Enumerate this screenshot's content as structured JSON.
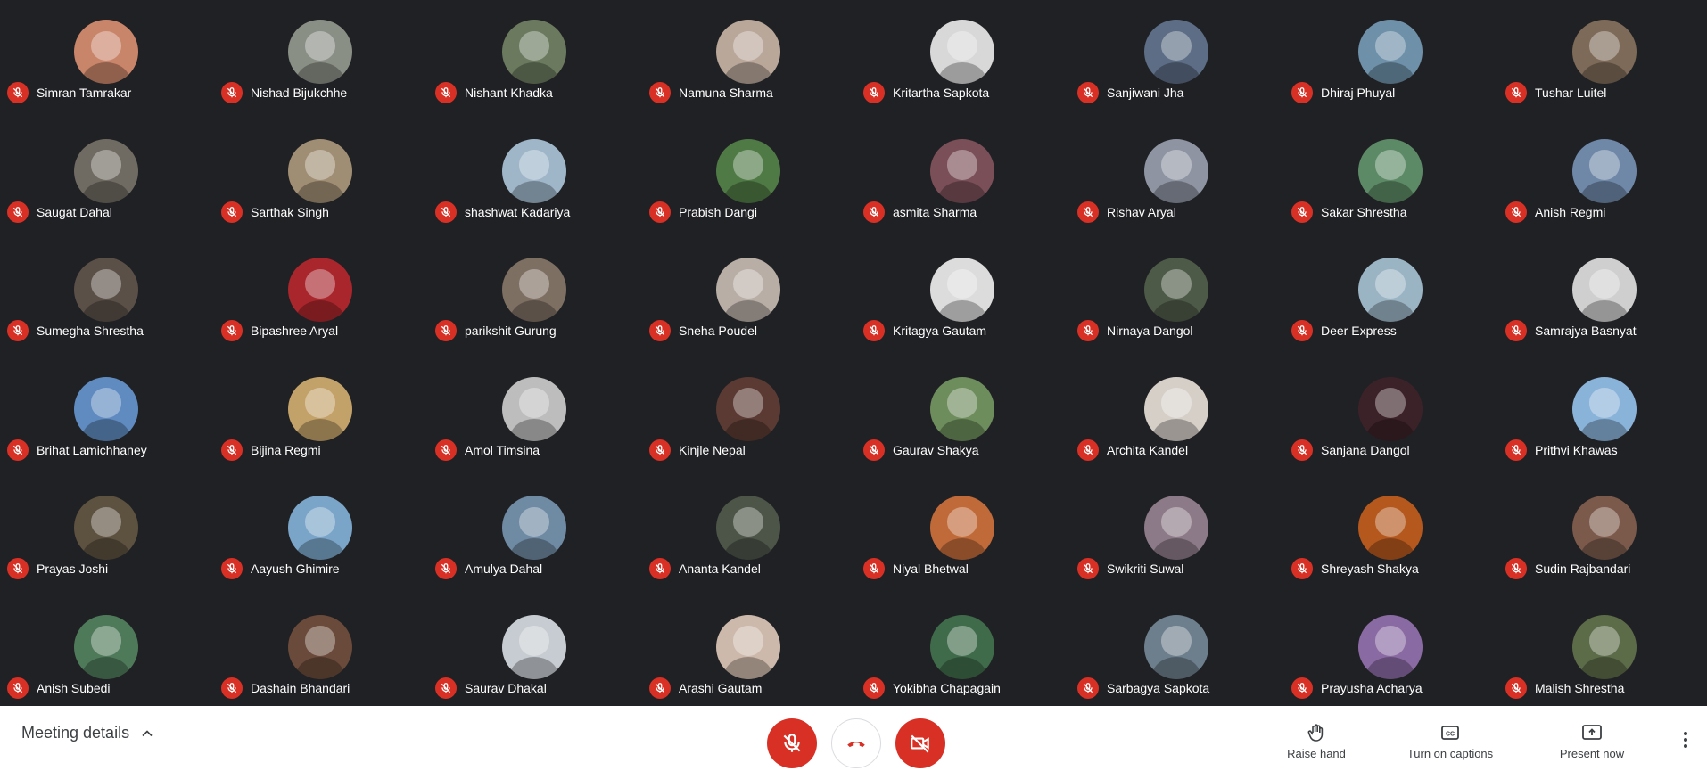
{
  "participants": [
    {
      "name": "Simran Tamrakar",
      "color": "#c9856a"
    },
    {
      "name": "Nishad Bijukchhe",
      "color": "#8a8f86"
    },
    {
      "name": "Nishant Khadka",
      "color": "#6b7a5f"
    },
    {
      "name": "Namuna Sharma",
      "color": "#b9a79a"
    },
    {
      "name": "Kritartha Sapkota",
      "color": "#d8d8d8"
    },
    {
      "name": "Sanjiwani Jha",
      "color": "#5c6d85"
    },
    {
      "name": "Dhiraj Phuyal",
      "color": "#6e90a8"
    },
    {
      "name": "Tushar Luitel",
      "color": "#7d6a58"
    },
    {
      "name": "Saugat Dahal",
      "color": "#6f6a62"
    },
    {
      "name": "Sarthak Singh",
      "color": "#a08e74"
    },
    {
      "name": "shashwat Kadariya",
      "color": "#9fb6c9"
    },
    {
      "name": "Prabish Dangi",
      "color": "#4f7a45"
    },
    {
      "name": "asmita Sharma",
      "color": "#7a4f58"
    },
    {
      "name": "Rishav Aryal",
      "color": "#8e94a2"
    },
    {
      "name": "Sakar Shrestha",
      "color": "#5d8a66"
    },
    {
      "name": "Anish Regmi",
      "color": "#6f88a8"
    },
    {
      "name": "Sumegha Shrestha",
      "color": "#5b5048"
    },
    {
      "name": "Bipashree Aryal",
      "color": "#a8262c"
    },
    {
      "name": "parikshit Gurung",
      "color": "#7e6f63"
    },
    {
      "name": "Sneha Poudel",
      "color": "#b8aea6"
    },
    {
      "name": "Kritagya Gautam",
      "color": "#dcdcdc"
    },
    {
      "name": "Nirnaya Dangol",
      "color": "#4e5a48"
    },
    {
      "name": "Deer Express",
      "color": "#9ab4c4"
    },
    {
      "name": "Samrajya Basnyat",
      "color": "#cfcfcf"
    },
    {
      "name": "Brihat Lamichhaney",
      "color": "#5f8bc0"
    },
    {
      "name": "Bijina Regmi",
      "color": "#c3a26a"
    },
    {
      "name": "Amol Timsina",
      "color": "#bdbdbd"
    },
    {
      "name": "Kinjle Nepal",
      "color": "#5a3a33"
    },
    {
      "name": "Gaurav Shakya",
      "color": "#6d8d5c"
    },
    {
      "name": "Archita Kandel",
      "color": "#d6cfc8"
    },
    {
      "name": "Sanjana Dangol",
      "color": "#3b2228"
    },
    {
      "name": "Prithvi Khawas",
      "color": "#8ab3d9"
    },
    {
      "name": "Prayas Joshi",
      "color": "#5d5140"
    },
    {
      "name": "Aayush Ghimire",
      "color": "#7aa5c8"
    },
    {
      "name": "Amulya Dahal",
      "color": "#6f8aa3"
    },
    {
      "name": "Ananta Kandel",
      "color": "#4d5548"
    },
    {
      "name": "Niyal Bhetwal",
      "color": "#c06a3a"
    },
    {
      "name": "Swikriti Suwal",
      "color": "#8c7a88"
    },
    {
      "name": "Shreyash Shakya",
      "color": "#b4581e"
    },
    {
      "name": "Sudin Rajbandari",
      "color": "#7b5a4b"
    },
    {
      "name": "Anish Subedi",
      "color": "#4f7a5a"
    },
    {
      "name": "Dashain Bhandari",
      "color": "#6a4a3a"
    },
    {
      "name": "Saurav Dhakal",
      "color": "#c7ccd2"
    },
    {
      "name": "Arashi Gautam",
      "color": "#cdb9ab"
    },
    {
      "name": "Yokibha Chapagain",
      "color": "#3f6b4a"
    },
    {
      "name": "Sarbagya Sapkota",
      "color": "#6d7e8d"
    },
    {
      "name": "Prayusha Acharya",
      "color": "#8a6aa3"
    },
    {
      "name": "Malish Shrestha",
      "color": "#5c6b48"
    }
  ],
  "bar": {
    "meeting_details": "Meeting details",
    "raise_hand": "Raise hand",
    "captions": "Turn on captions",
    "present": "Present now"
  },
  "colors": {
    "background": "#202124",
    "mute_red": "#d93025",
    "bar_bg": "#ffffff",
    "bar_text": "#3c4043"
  },
  "icons": {
    "participant_status": "mic-off-icon",
    "meeting_details": "chevron-up-icon",
    "mic": "mic-off-icon",
    "hangup": "phone-hangup-icon",
    "camera": "videocam-off-icon",
    "raise_hand": "hand-icon",
    "captions": "closed-captions-icon",
    "present": "present-screen-icon",
    "more": "more-vertical-icon"
  }
}
